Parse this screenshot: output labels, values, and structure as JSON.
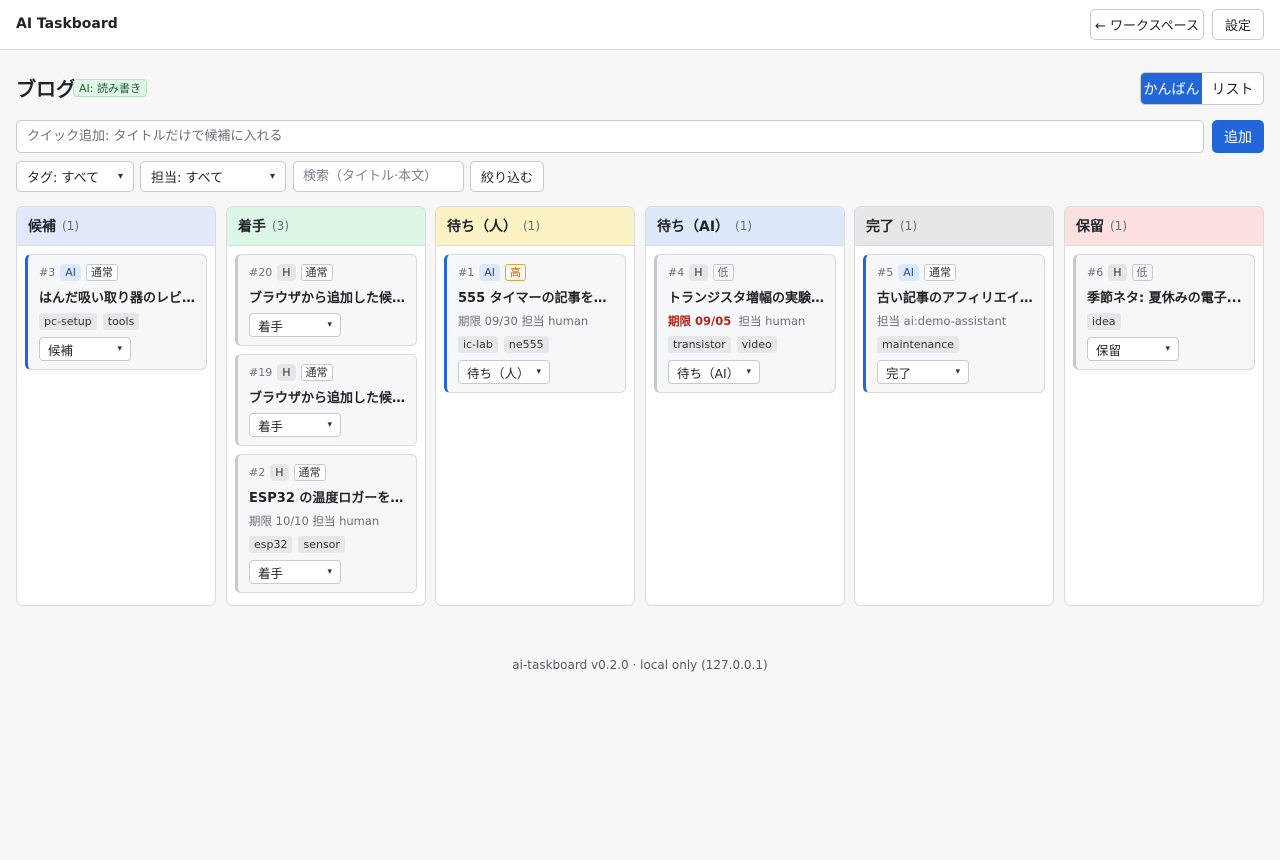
{
  "app": {
    "title": "AI Taskboard"
  },
  "header": {
    "workspace_label": "← ワークスペース",
    "settings_label": "設定"
  },
  "board": {
    "title": "ブログ",
    "ai_badge": "AI: 読み書き"
  },
  "view": {
    "kanban_label": "かんばん",
    "list_label": "リスト",
    "active": "kanban"
  },
  "quick_add": {
    "placeholder": "クイック追加: タイトルだけで候補に入れる",
    "value": "",
    "button_label": "追加"
  },
  "filters": {
    "tag_select": "タグ: すべて",
    "assignee_select": "担当: すべて",
    "search_placeholder": "検索（タイトル·本文）",
    "search_value": "",
    "apply_label": "絞り込む"
  },
  "columns": [
    {
      "name": "候補",
      "count": "(1)",
      "color": "#e4e8fb",
      "cards": [
        {
          "id": "#3",
          "who": "AI",
          "priority": "通常",
          "title": "はんだ吸い取り器のレビュ...",
          "sub": "",
          "tags": [
            "pc-setup",
            "tools"
          ],
          "status": "候補"
        }
      ]
    },
    {
      "name": "着手",
      "count": "(3)",
      "color": "#dcf7e5",
      "cards": [
        {
          "id": "#20",
          "who": "H",
          "priority": "通常",
          "title": "ブラウザから追加した候補...",
          "sub": "",
          "tags": [],
          "status": "着手"
        },
        {
          "id": "#19",
          "who": "H",
          "priority": "通常",
          "title": "ブラウザから追加した候補 ...",
          "sub": "",
          "tags": [],
          "status": "着手"
        },
        {
          "id": "#2",
          "who": "H",
          "priority": "通常",
          "title": "ESP32 の温度ロガーを 1 ...",
          "sub": "期限 10/10  担当 human",
          "tags": [
            "esp32",
            "sensor"
          ],
          "status": "着手"
        }
      ]
    },
    {
      "name": "待ち（人）",
      "count": "(1)",
      "color": "#fdf2c4",
      "cards": [
        {
          "id": "#1",
          "who": "AI",
          "priority": "高",
          "title": "555 タイマーの記事を書く...",
          "sub": "期限 09/30  担当 human",
          "tags": [
            "ic-lab",
            "ne555"
          ],
          "status": "待ち（人）"
        }
      ]
    },
    {
      "name": "待ち（AI）",
      "count": "(1)",
      "color": "#dde8fb",
      "cards": [
        {
          "id": "#4",
          "who": "H",
          "priority": "低",
          "title": "トランジスタ増幅の実験を...",
          "due": "期限 09/05",
          "assignee": "担当 human",
          "tags": [
            "transistor",
            "video"
          ],
          "status": "待ち（AI）"
        }
      ]
    },
    {
      "name": "完了",
      "count": "(1)",
      "color": "#e6e7ea",
      "cards": [
        {
          "id": "#5",
          "who": "AI",
          "priority": "通常",
          "title": "古い記事のアフィリエイトリ...",
          "sub": "担当 ai:demo-assistant",
          "tags": [
            "maintenance"
          ],
          "status": "完了"
        }
      ]
    },
    {
      "name": "保留",
      "count": "(1)",
      "color": "#fde1e1",
      "cards": [
        {
          "id": "#6",
          "who": "H",
          "priority": "低",
          "title": "季節ネタ: 夏休みの電子...",
          "sub": "",
          "tags": [
            "idea"
          ],
          "status": "保留"
        }
      ]
    }
  ],
  "footer": {
    "text": "ai-taskboard v0.2.0 · local only (127.0.0.1)"
  }
}
